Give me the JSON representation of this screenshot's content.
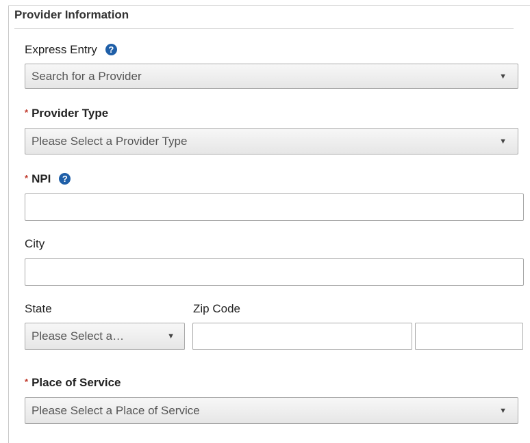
{
  "section": {
    "title": "Provider Information"
  },
  "express_entry": {
    "label": "Express Entry",
    "help": "?",
    "placeholder": "Search for a Provider",
    "arrow": "▼"
  },
  "provider_type": {
    "required_mark": "*",
    "label": "Provider Type",
    "placeholder": "Please Select a Provider Type",
    "arrow": "▼"
  },
  "npi": {
    "required_mark": "*",
    "label": "NPI",
    "help": "?",
    "value": ""
  },
  "city": {
    "label": "City",
    "value": ""
  },
  "state": {
    "label": "State",
    "placeholder": "Please Select a…",
    "arrow": "▼"
  },
  "zip": {
    "label": "Zip Code",
    "value": "",
    "ext_value": ""
  },
  "place_of_service": {
    "required_mark": "*",
    "label": "Place of Service",
    "placeholder": "Please Select a Place of Service",
    "arrow": "▼"
  },
  "colors": {
    "required": "#c0392b",
    "help_icon": "#1f5fa8",
    "border": "#a9a9a9"
  }
}
